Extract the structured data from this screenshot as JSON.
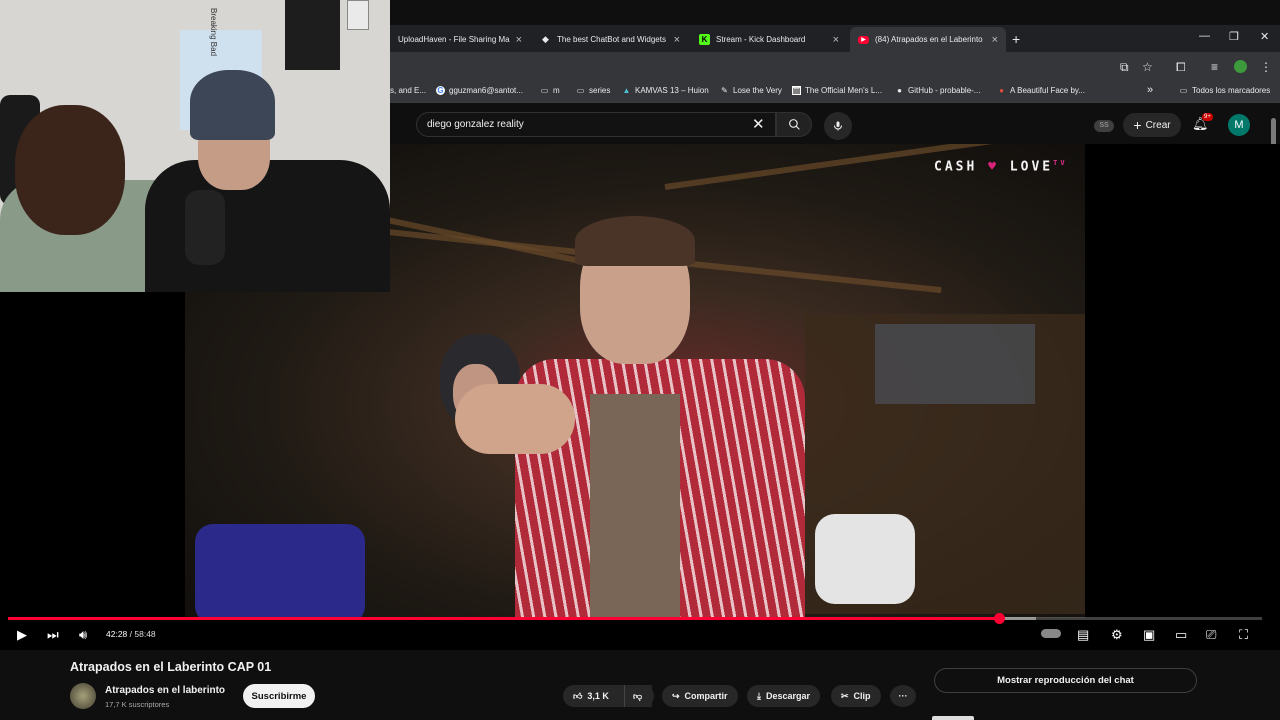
{
  "browser": {
    "tabs": [
      {
        "title": "UploadHaven - File Sharing Ma",
        "icon": "globe-icon"
      },
      {
        "title": "The best ChatBot and Widgets",
        "icon": "diamond-icon"
      },
      {
        "title": "Stream - Kick Dashboard",
        "icon": "kick-icon"
      },
      {
        "title": "(84) Atrapados en el Laberinto",
        "icon": "youtube-icon",
        "active": true
      }
    ],
    "new_tab": "+",
    "bookmarks": [
      {
        "label": "s, and E..."
      },
      {
        "label": "gguzman6@santot...",
        "icon": "google-icon"
      },
      {
        "label": "m",
        "icon": "folder-icon"
      },
      {
        "label": "series",
        "icon": "folder-icon"
      },
      {
        "label": "KAMVAS 13 – Huion",
        "icon": "huion-icon"
      },
      {
        "label": "Lose the Very",
        "icon": "pen-icon"
      },
      {
        "label": "The Official Men's L...",
        "icon": "doc-icon"
      },
      {
        "label": "GitHub - probable-...",
        "icon": "github-icon"
      },
      {
        "label": "A Beautiful Face by...",
        "icon": "face-icon"
      }
    ],
    "bookmarks_overflow": "»",
    "all_bookmarks": "Todos los marcadores"
  },
  "youtube": {
    "search": {
      "value": "diego gonzalez reality"
    },
    "ss_badge": "SS",
    "create_label": "Crear",
    "notifications": "9+",
    "avatar_letter": "M"
  },
  "video": {
    "watermark": {
      "left": "CASH",
      "right": "LOVE",
      "sup": "TV"
    },
    "current_time": "42:28",
    "separator": " / ",
    "duration": "58:48",
    "played_fraction": 0.79,
    "buffered_fraction": 0.82,
    "webcam_poster_text": "Breaking Bad",
    "accent": "#ff0033"
  },
  "meta": {
    "title": "Atrapados en el Laberinto CAP 01",
    "channel_name": "Atrapados en el laberinto",
    "subscribers": "17,7 K suscriptores",
    "subscribe_label": "Suscribirme",
    "likes": "3,1 K",
    "share_label": "Compartir",
    "download_label": "Descargar",
    "clip_label": "Clip",
    "more_label": "···",
    "chat_button": "Mostrar reproducción del chat"
  }
}
